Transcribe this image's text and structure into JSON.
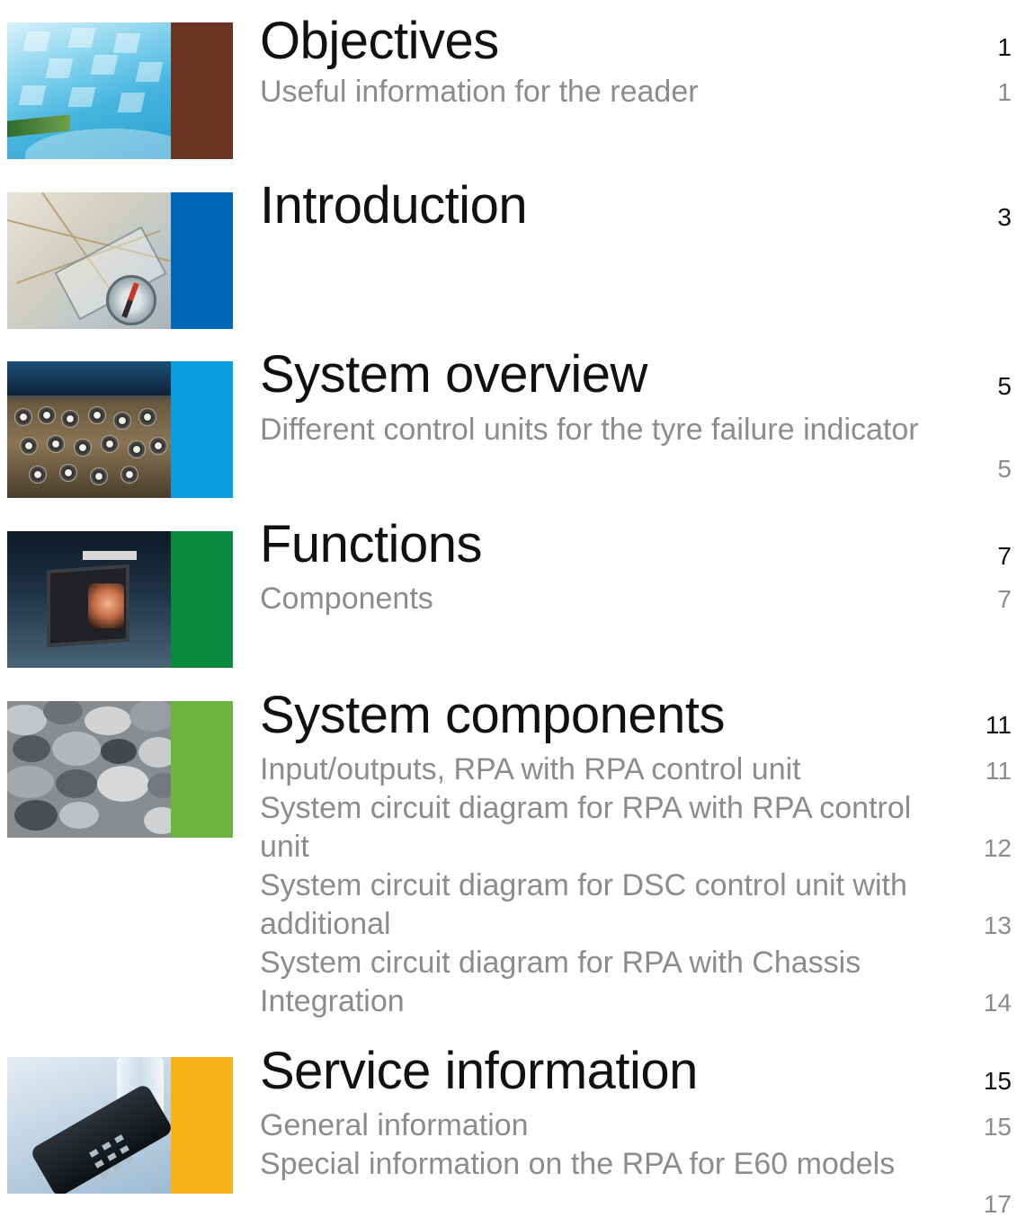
{
  "colors": {
    "objectives": "#6a3322",
    "introduction": "#0066b8",
    "system_overview": "#0a9ee0",
    "functions": "#0a8a3c",
    "system_components": "#6db33f",
    "service_information": "#f7b217"
  },
  "objectives": {
    "title": "Objectives",
    "page": "1",
    "items": [
      {
        "text": "Useful information for the reader",
        "page": "1"
      }
    ]
  },
  "introduction": {
    "title": "Introduction",
    "page": "3"
  },
  "system_overview": {
    "title": "System overview",
    "page": "5",
    "items": [
      {
        "text": "Different control units for the tyre failure indicator",
        "page": "5"
      }
    ]
  },
  "functions": {
    "title": "Functions",
    "page": "7",
    "items": [
      {
        "text": "Components",
        "page": "7"
      }
    ]
  },
  "system_components": {
    "title": "System components",
    "page": "11",
    "items": [
      {
        "text": "Input/outputs, RPA with RPA control unit",
        "page": "11"
      },
      {
        "text": "System circuit diagram for RPA with RPA control unit",
        "page": "12"
      },
      {
        "text": "System circuit diagram for DSC control unit with additional",
        "page": "13"
      },
      {
        "text": "System circuit diagram for RPA with Chassis Integration",
        "page": "14"
      }
    ]
  },
  "service_information": {
    "title": "Service information",
    "page": "15",
    "items": [
      {
        "text": "General information",
        "page": "15"
      },
      {
        "text": "Special information on the RPA for E60 models",
        "page": "17"
      }
    ]
  }
}
